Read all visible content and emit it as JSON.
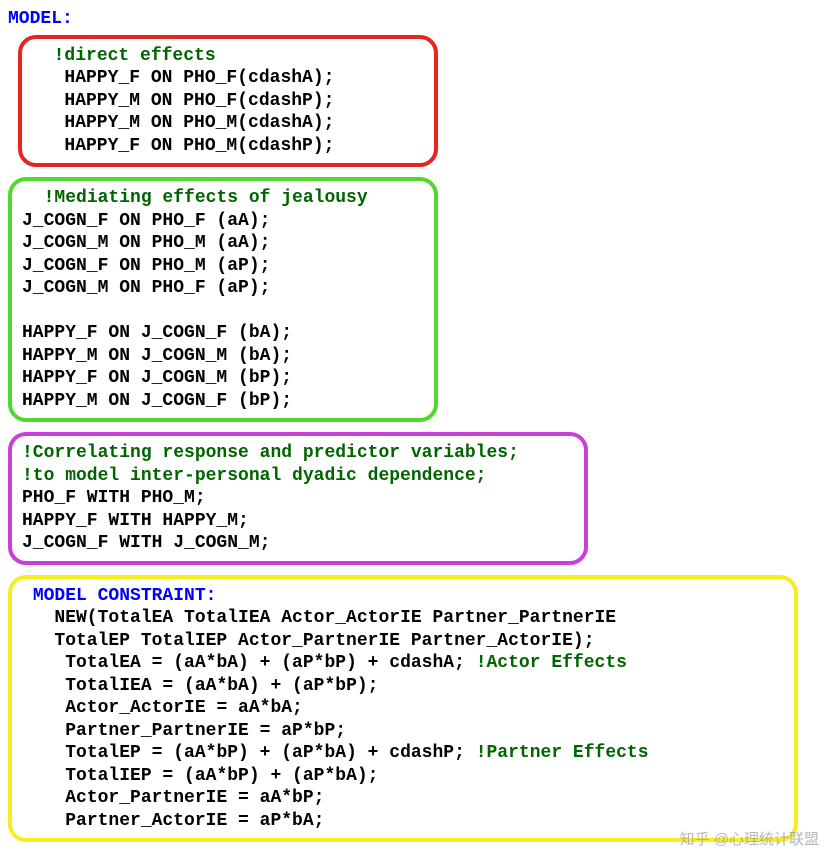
{
  "header": {
    "model_kw": "MODEL:"
  },
  "box_red": {
    "comment": "!direct effects",
    "lines": [
      "HAPPY_F ON PHO_F(cdashA);",
      "HAPPY_M ON PHO_F(cdashP);",
      "HAPPY_M ON PHO_M(cdashA);",
      "HAPPY_F ON PHO_M(cdashP);"
    ]
  },
  "box_green": {
    "comment": "!Mediating effects of jealousy",
    "lines_a": [
      "J_COGN_F ON PHO_F (aA);",
      "J_COGN_M ON PHO_M (aA);",
      "J_COGN_F ON PHO_M (aP);",
      "J_COGN_M ON PHO_F (aP);"
    ],
    "lines_b": [
      "HAPPY_F ON J_COGN_F (bA);",
      "HAPPY_M ON J_COGN_M (bA);",
      "HAPPY_F ON J_COGN_M (bP);",
      "HAPPY_M ON J_COGN_F (bP);"
    ]
  },
  "box_purple": {
    "comment1": "!Correlating response and predictor variables;",
    "comment2": "!to model inter-personal dyadic dependence;",
    "lines": [
      "PHO_F WITH PHO_M;",
      "HAPPY_F WITH HAPPY_M;",
      "J_COGN_F WITH J_COGN_M;"
    ]
  },
  "box_yellow": {
    "kw": "MODEL CONSTRAINT:",
    "new1": "NEW(TotalEA TotalIEA Actor_ActorIE Partner_PartnerIE",
    "new2": "TotalEP TotalIEP Actor_PartnerIE Partner_ActorIE);",
    "line_totalEA_code": "TotalEA = (aA*bA) + (aP*bP) + cdashA;",
    "line_totalEA_comment": "!Actor Effects",
    "line_totalIEA": "TotalIEA = (aA*bA) + (aP*bP);",
    "line_actorActor": "Actor_ActorIE = aA*bA;",
    "line_partnerPartner": "Partner_PartnerIE = aP*bP;",
    "line_totalEP_code": "TotalEP = (aA*bP) + (aP*bA) + cdashP;",
    "line_totalEP_comment": "!Partner Effects",
    "line_totalIEP": "TotalIEP = (aA*bP) + (aP*bA);",
    "line_actorPartner": "Actor_PartnerIE = aA*bP;",
    "line_partnerActor": "Partner_ActorIE = aP*bA;"
  },
  "watermark": "知乎 @心理统计联盟"
}
